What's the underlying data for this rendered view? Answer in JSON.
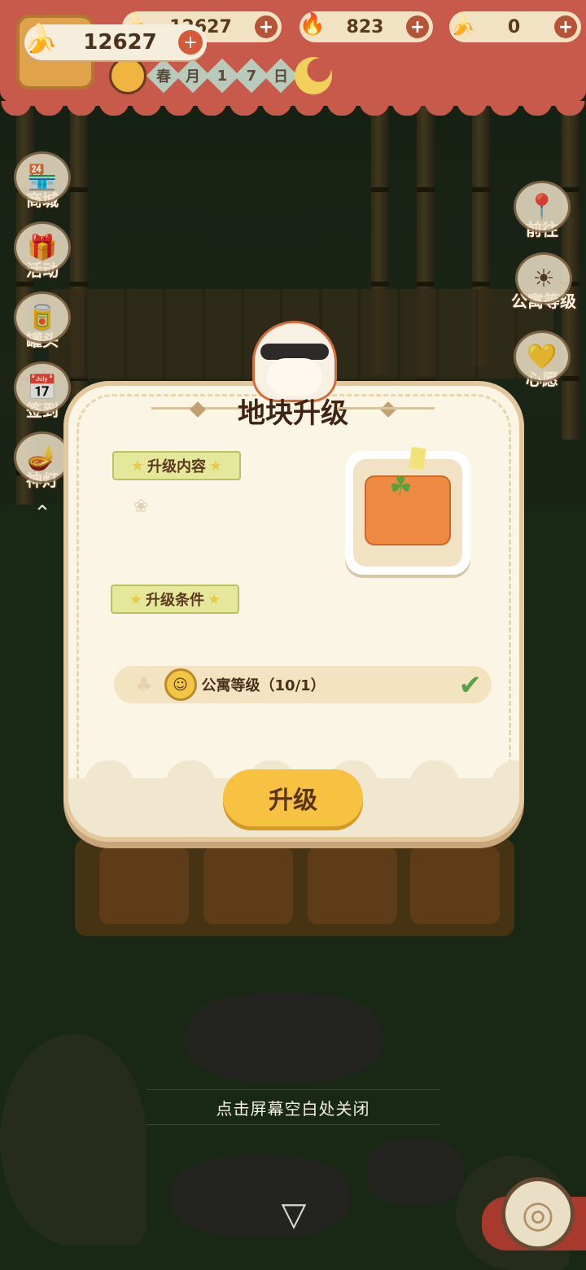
{
  "currencies": {
    "banana_main": {
      "value": "12627",
      "icon": "banana-icon"
    },
    "banana_bar": {
      "value": "12627",
      "icon": "banana-icon"
    },
    "blue_fire": {
      "value": "823",
      "icon": "blue-flame-icon"
    },
    "blue_banana": {
      "value": "0",
      "icon": "blue-banana-icon"
    },
    "plus_symbol": "+"
  },
  "date": {
    "chars": [
      "春",
      "月",
      "1",
      "7",
      "日"
    ]
  },
  "side_left": [
    {
      "label": "商城",
      "icon": "shop-icon"
    },
    {
      "label": "活动",
      "icon": "gift-icon"
    },
    {
      "label": "罐头",
      "icon": "can-icon"
    },
    {
      "label": "签到",
      "icon": "calendar-icon"
    },
    {
      "label": "神灯",
      "icon": "lamp-icon"
    }
  ],
  "side_right": [
    {
      "label": "前往",
      "icon": "map-pin-icon"
    },
    {
      "label": "公寓等级",
      "icon": "apartment-level-icon"
    },
    {
      "label": "心愿",
      "icon": "wish-book-icon"
    }
  ],
  "dialog": {
    "title": "地块升级",
    "section_content": "升级内容",
    "section_condition": "升级条件",
    "condition_text": "公寓等级（10/1）",
    "upgrade_button": "升级"
  },
  "close_hint": "点击屏幕空白处关闭",
  "colors": {
    "accent": "#f7c242",
    "topbar": "#c75a4a",
    "dialog_bg": "#fbf5e6",
    "check": "#5aa14a"
  }
}
